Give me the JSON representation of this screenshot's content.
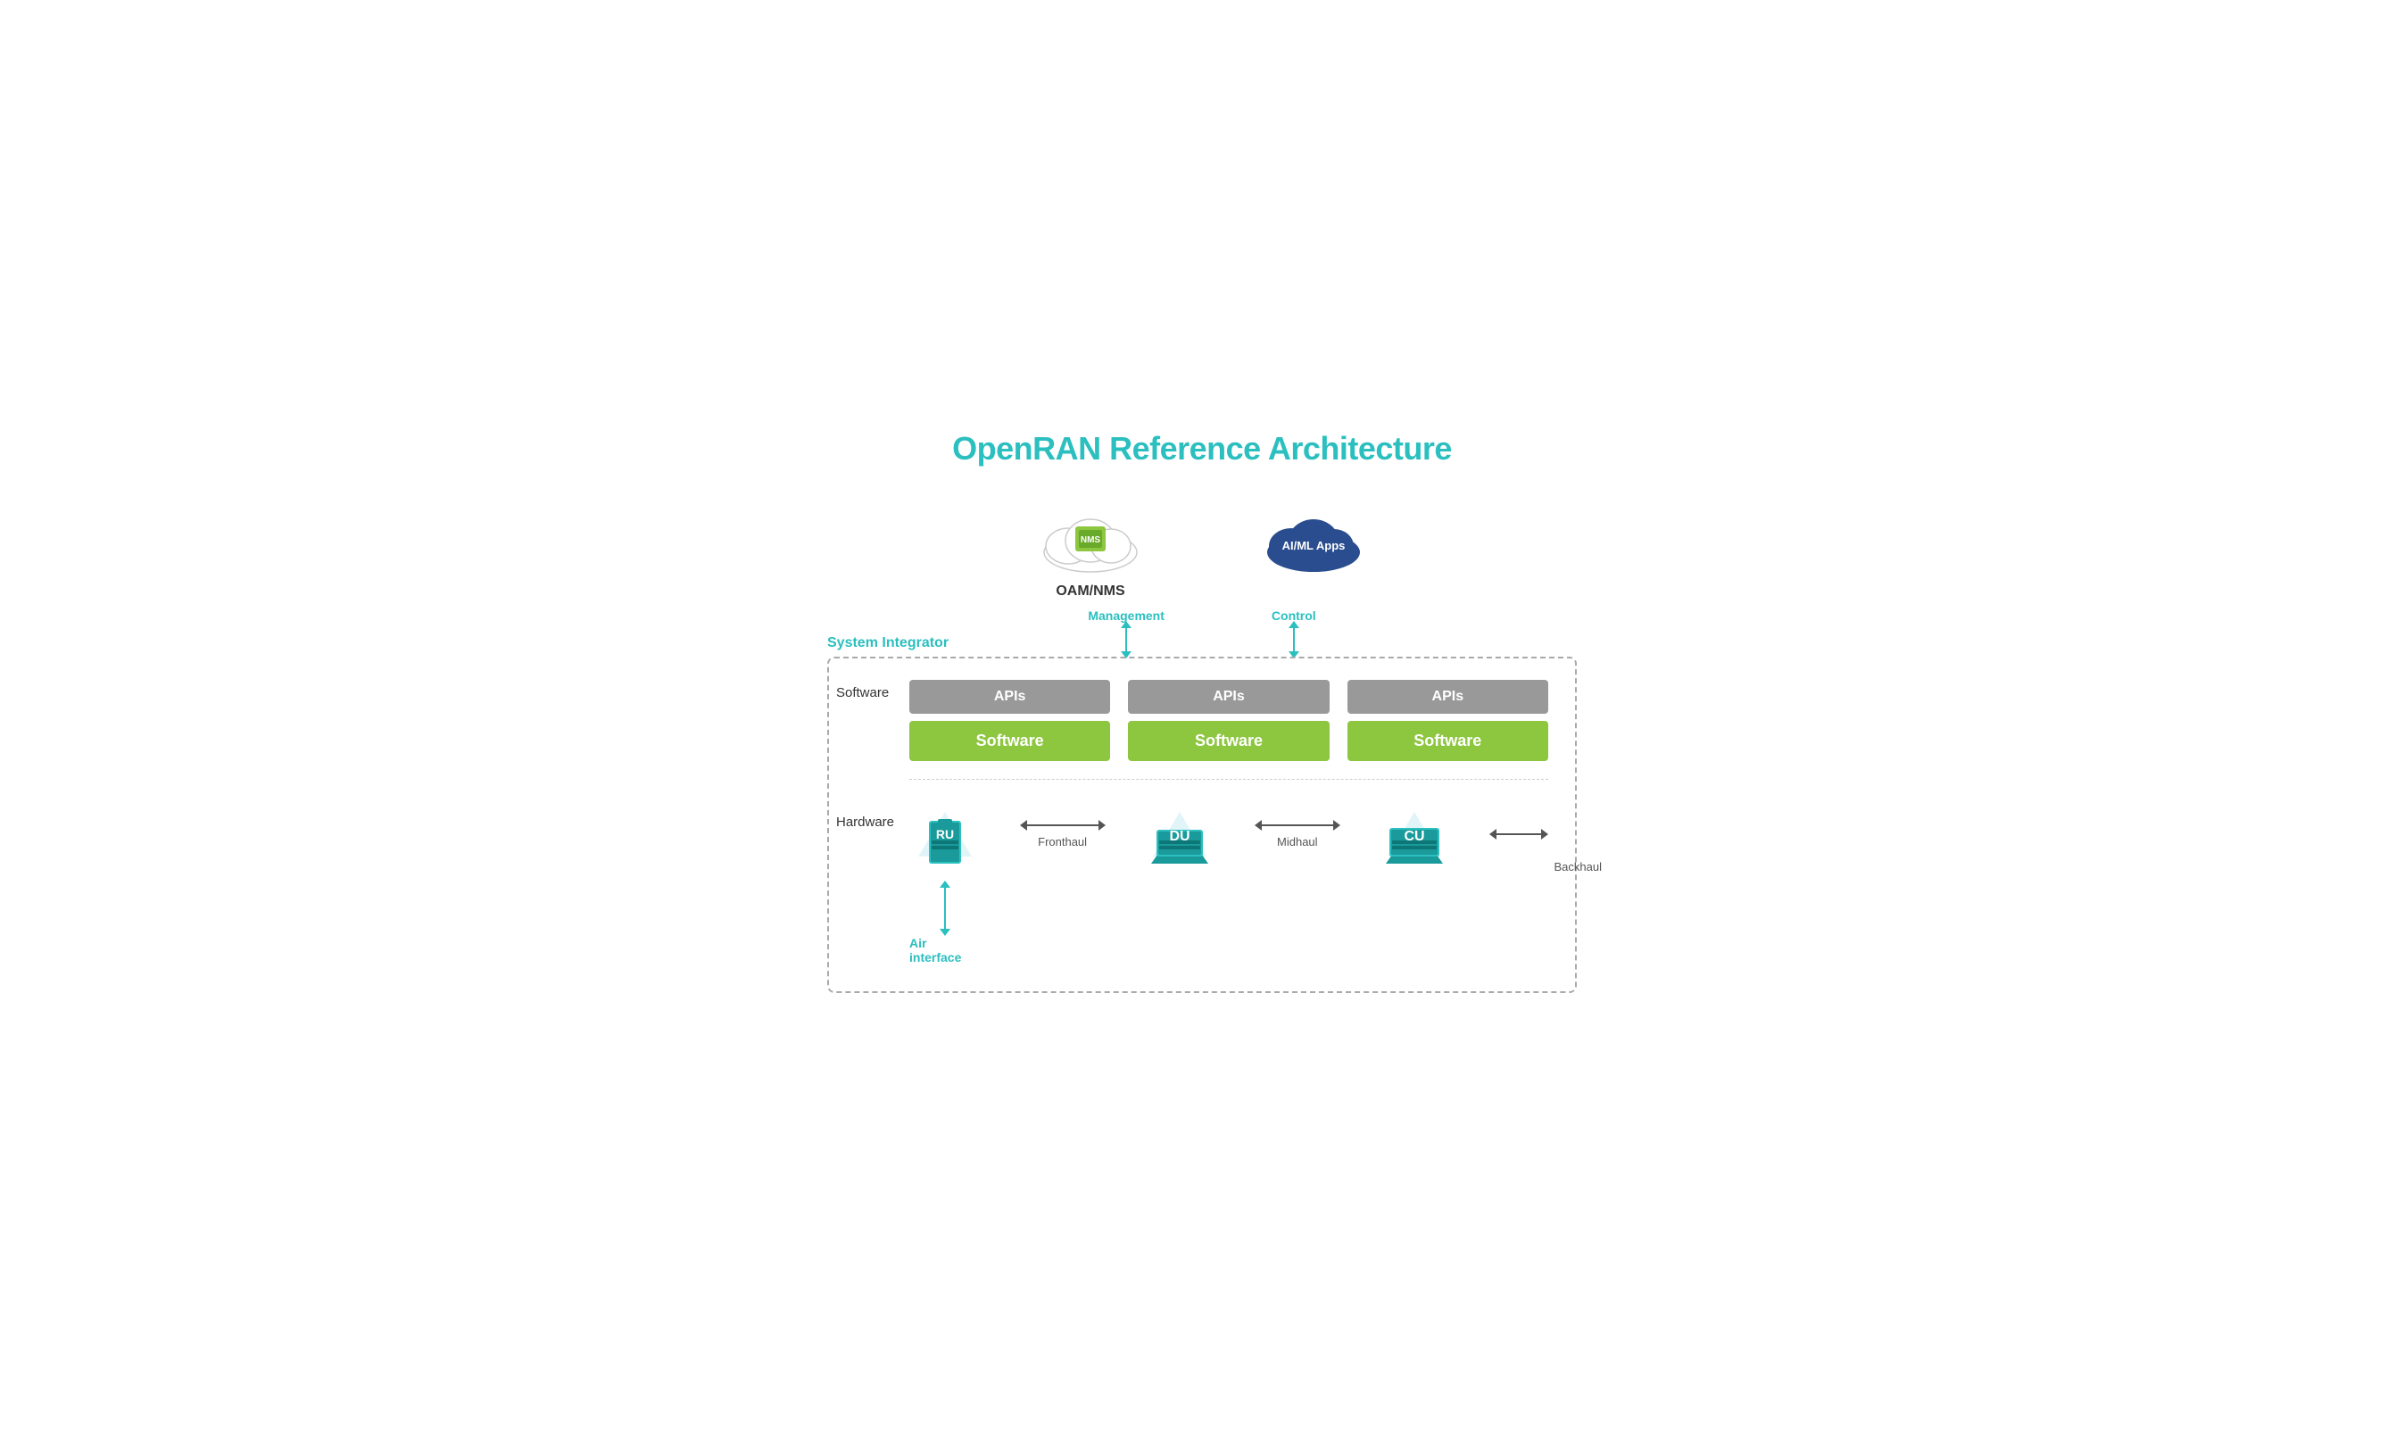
{
  "title": "OpenRAN Reference Architecture",
  "clouds": {
    "oam": {
      "label": "OAM/NMS",
      "connector_label": "Management"
    },
    "aiml": {
      "label": "AI/ML Apps",
      "connector_label": "Control"
    }
  },
  "system_integrator": {
    "label": "System Integrator",
    "software_row_label": "Software",
    "hardware_row_label": "Hardware"
  },
  "columns": [
    {
      "api_label": "APIs",
      "software_label": "Software",
      "device_name": "RU",
      "device_type": "ru"
    },
    {
      "api_label": "APIs",
      "software_label": "Software",
      "device_name": "DU",
      "device_type": "du"
    },
    {
      "api_label": "APIs",
      "software_label": "Software",
      "device_name": "CU",
      "device_type": "cu"
    }
  ],
  "connectors": [
    {
      "label": "Fronthaul"
    },
    {
      "label": "Midhaul"
    }
  ],
  "backhaul_label": "Backhaul",
  "air_interface_label": "Air interface"
}
